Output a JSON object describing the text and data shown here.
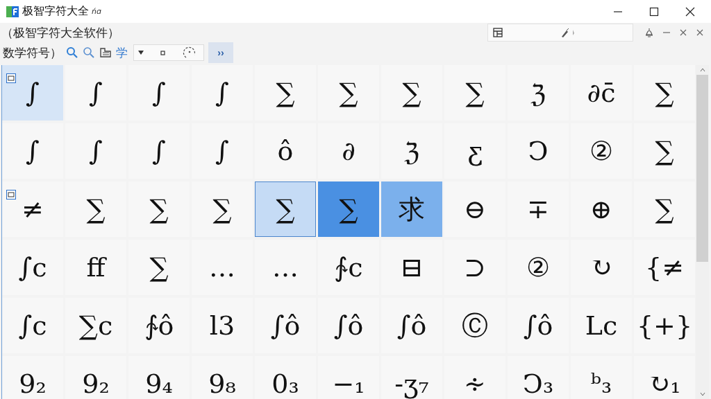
{
  "window": {
    "title": "极智字符大全",
    "title_suffix": "ńɑ"
  },
  "header": {
    "text": "（极智字符大全软件）"
  },
  "toolbar": {
    "category": "数学符号）",
    "mode_label": "学",
    "expand": "››"
  },
  "grid": {
    "rows": [
      {
        "cells": [
          {
            "symbol": "∫",
            "selected": false,
            "focused": false,
            "hovered": true,
            "pressed": false,
            "tagged": true
          },
          {
            "symbol": "∫",
            "selected": false,
            "focused": false,
            "hovered": false,
            "pressed": false,
            "tagged": false
          },
          {
            "symbol": "∫",
            "selected": false,
            "focused": false,
            "hovered": false,
            "pressed": false,
            "tagged": false
          },
          {
            "symbol": "∫",
            "selected": false,
            "focused": false,
            "hovered": false,
            "pressed": false,
            "tagged": false
          },
          {
            "symbol": "∑",
            "selected": false,
            "focused": false,
            "hovered": false,
            "pressed": false,
            "tagged": false
          },
          {
            "symbol": "∑",
            "selected": false,
            "focused": false,
            "hovered": false,
            "pressed": false,
            "tagged": false
          },
          {
            "symbol": "∑",
            "selected": false,
            "focused": false,
            "hovered": false,
            "pressed": false,
            "tagged": false
          },
          {
            "symbol": "∑",
            "selected": false,
            "focused": false,
            "hovered": false,
            "pressed": false,
            "tagged": false
          },
          {
            "symbol": "ℨ",
            "selected": false,
            "focused": false,
            "hovered": false,
            "pressed": false,
            "tagged": false
          },
          {
            "symbol": "∂c̄",
            "selected": false,
            "focused": false,
            "hovered": false,
            "pressed": false,
            "tagged": false
          },
          {
            "symbol": "∑",
            "selected": false,
            "focused": false,
            "hovered": false,
            "pressed": false,
            "tagged": false
          }
        ]
      },
      {
        "cells": [
          {
            "symbol": "∫",
            "selected": false,
            "focused": false,
            "hovered": false,
            "pressed": false,
            "tagged": false
          },
          {
            "symbol": "∫",
            "selected": false,
            "focused": false,
            "hovered": false,
            "pressed": false,
            "tagged": false
          },
          {
            "symbol": "∫",
            "selected": false,
            "focused": false,
            "hovered": false,
            "pressed": false,
            "tagged": false
          },
          {
            "symbol": "∫",
            "selected": false,
            "focused": false,
            "hovered": false,
            "pressed": false,
            "tagged": false
          },
          {
            "symbol": "ô",
            "selected": false,
            "focused": false,
            "hovered": false,
            "pressed": false,
            "tagged": false
          },
          {
            "symbol": "∂",
            "selected": false,
            "focused": false,
            "hovered": false,
            "pressed": false,
            "tagged": false
          },
          {
            "symbol": "ℨ",
            "selected": false,
            "focused": false,
            "hovered": false,
            "pressed": false,
            "tagged": false
          },
          {
            "symbol": "ƹ",
            "selected": false,
            "focused": false,
            "hovered": false,
            "pressed": false,
            "tagged": false
          },
          {
            "symbol": "Ↄ",
            "selected": false,
            "focused": false,
            "hovered": false,
            "pressed": false,
            "tagged": false
          },
          {
            "symbol": "②",
            "selected": false,
            "focused": false,
            "hovered": false,
            "pressed": false,
            "tagged": false
          },
          {
            "symbol": "∑",
            "selected": false,
            "focused": false,
            "hovered": false,
            "pressed": false,
            "tagged": false
          }
        ]
      },
      {
        "cells": [
          {
            "symbol": "≠",
            "selected": false,
            "focused": false,
            "hovered": false,
            "pressed": false,
            "tagged": true
          },
          {
            "symbol": "∑",
            "selected": false,
            "focused": false,
            "hovered": false,
            "pressed": false,
            "tagged": false
          },
          {
            "symbol": "∑",
            "selected": false,
            "focused": false,
            "hovered": false,
            "pressed": false,
            "tagged": false
          },
          {
            "symbol": "∑",
            "selected": false,
            "focused": false,
            "hovered": false,
            "pressed": false,
            "tagged": false
          },
          {
            "symbol": "∑",
            "selected": false,
            "focused": true,
            "hovered": false,
            "pressed": false,
            "tagged": false
          },
          {
            "symbol": "∑",
            "selected": true,
            "focused": false,
            "hovered": false,
            "pressed": false,
            "tagged": false
          },
          {
            "symbol": "求",
            "selected": false,
            "focused": false,
            "hovered": false,
            "pressed": true,
            "tagged": false
          },
          {
            "symbol": "⊖",
            "selected": false,
            "focused": false,
            "hovered": false,
            "pressed": false,
            "tagged": false
          },
          {
            "symbol": "∓",
            "selected": false,
            "focused": false,
            "hovered": false,
            "pressed": false,
            "tagged": false
          },
          {
            "symbol": "⊕",
            "selected": false,
            "focused": false,
            "hovered": false,
            "pressed": false,
            "tagged": false
          },
          {
            "symbol": "∑",
            "selected": false,
            "focused": false,
            "hovered": false,
            "pressed": false,
            "tagged": false
          }
        ]
      },
      {
        "cells": [
          {
            "symbol": "∫c",
            "selected": false,
            "focused": false,
            "hovered": false,
            "pressed": false,
            "tagged": false
          },
          {
            "symbol": "ff",
            "selected": false,
            "focused": false,
            "hovered": false,
            "pressed": false,
            "tagged": false
          },
          {
            "symbol": "∑",
            "selected": false,
            "focused": false,
            "hovered": false,
            "pressed": false,
            "tagged": false
          },
          {
            "symbol": "…",
            "selected": false,
            "focused": false,
            "hovered": false,
            "pressed": false,
            "tagged": false
          },
          {
            "symbol": "…",
            "selected": false,
            "focused": false,
            "hovered": false,
            "pressed": false,
            "tagged": false
          },
          {
            "symbol": "∱c",
            "selected": false,
            "focused": false,
            "hovered": false,
            "pressed": false,
            "tagged": false
          },
          {
            "symbol": "⊟",
            "selected": false,
            "focused": false,
            "hovered": false,
            "pressed": false,
            "tagged": false
          },
          {
            "symbol": "⊃",
            "selected": false,
            "focused": false,
            "hovered": false,
            "pressed": false,
            "tagged": false
          },
          {
            "symbol": "②",
            "selected": false,
            "focused": false,
            "hovered": false,
            "pressed": false,
            "tagged": false
          },
          {
            "symbol": "↻",
            "selected": false,
            "focused": false,
            "hovered": false,
            "pressed": false,
            "tagged": false
          },
          {
            "symbol": "{≠",
            "selected": false,
            "focused": false,
            "hovered": false,
            "pressed": false,
            "tagged": false
          }
        ]
      },
      {
        "cells": [
          {
            "symbol": "∫c",
            "selected": false,
            "focused": false,
            "hovered": false,
            "pressed": false,
            "tagged": false
          },
          {
            "symbol": "∑c",
            "selected": false,
            "focused": false,
            "hovered": false,
            "pressed": false,
            "tagged": false
          },
          {
            "symbol": "∱ô",
            "selected": false,
            "focused": false,
            "hovered": false,
            "pressed": false,
            "tagged": false
          },
          {
            "symbol": "l3",
            "selected": false,
            "focused": false,
            "hovered": false,
            "pressed": false,
            "tagged": false
          },
          {
            "symbol": "∫ô",
            "selected": false,
            "focused": false,
            "hovered": false,
            "pressed": false,
            "tagged": false
          },
          {
            "symbol": "∫ô",
            "selected": false,
            "focused": false,
            "hovered": false,
            "pressed": false,
            "tagged": false
          },
          {
            "symbol": "∫ô",
            "selected": false,
            "focused": false,
            "hovered": false,
            "pressed": false,
            "tagged": false
          },
          {
            "symbol": "Ⓒ",
            "selected": false,
            "focused": false,
            "hovered": false,
            "pressed": false,
            "tagged": false
          },
          {
            "symbol": "∫ô",
            "selected": false,
            "focused": false,
            "hovered": false,
            "pressed": false,
            "tagged": false
          },
          {
            "symbol": "Lc",
            "selected": false,
            "focused": false,
            "hovered": false,
            "pressed": false,
            "tagged": false
          },
          {
            "symbol": "{+}",
            "selected": false,
            "focused": false,
            "hovered": false,
            "pressed": false,
            "tagged": false
          }
        ]
      },
      {
        "cells": [
          {
            "symbol": "9₂",
            "selected": false,
            "focused": false,
            "hovered": false,
            "pressed": false,
            "tagged": false
          },
          {
            "symbol": "9₂",
            "selected": false,
            "focused": false,
            "hovered": false,
            "pressed": false,
            "tagged": false
          },
          {
            "symbol": "9₄",
            "selected": false,
            "focused": false,
            "hovered": false,
            "pressed": false,
            "tagged": false
          },
          {
            "symbol": "9₈",
            "selected": false,
            "focused": false,
            "hovered": false,
            "pressed": false,
            "tagged": false
          },
          {
            "symbol": "0₃",
            "selected": false,
            "focused": false,
            "hovered": false,
            "pressed": false,
            "tagged": false
          },
          {
            "symbol": "−₁",
            "selected": false,
            "focused": false,
            "hovered": false,
            "pressed": false,
            "tagged": false
          },
          {
            "symbol": "-ʒ₇",
            "selected": false,
            "focused": false,
            "hovered": false,
            "pressed": false,
            "tagged": false
          },
          {
            "symbol": "∻",
            "selected": false,
            "focused": false,
            "hovered": false,
            "pressed": false,
            "tagged": false
          },
          {
            "symbol": "Ↄ₃",
            "selected": false,
            "focused": false,
            "hovered": false,
            "pressed": false,
            "tagged": false
          },
          {
            "symbol": "ᵇ₃",
            "selected": false,
            "focused": false,
            "hovered": false,
            "pressed": false,
            "tagged": false
          },
          {
            "symbol": "↻₁",
            "selected": false,
            "focused": false,
            "hovered": false,
            "pressed": false,
            "tagged": false
          }
        ]
      }
    ]
  }
}
